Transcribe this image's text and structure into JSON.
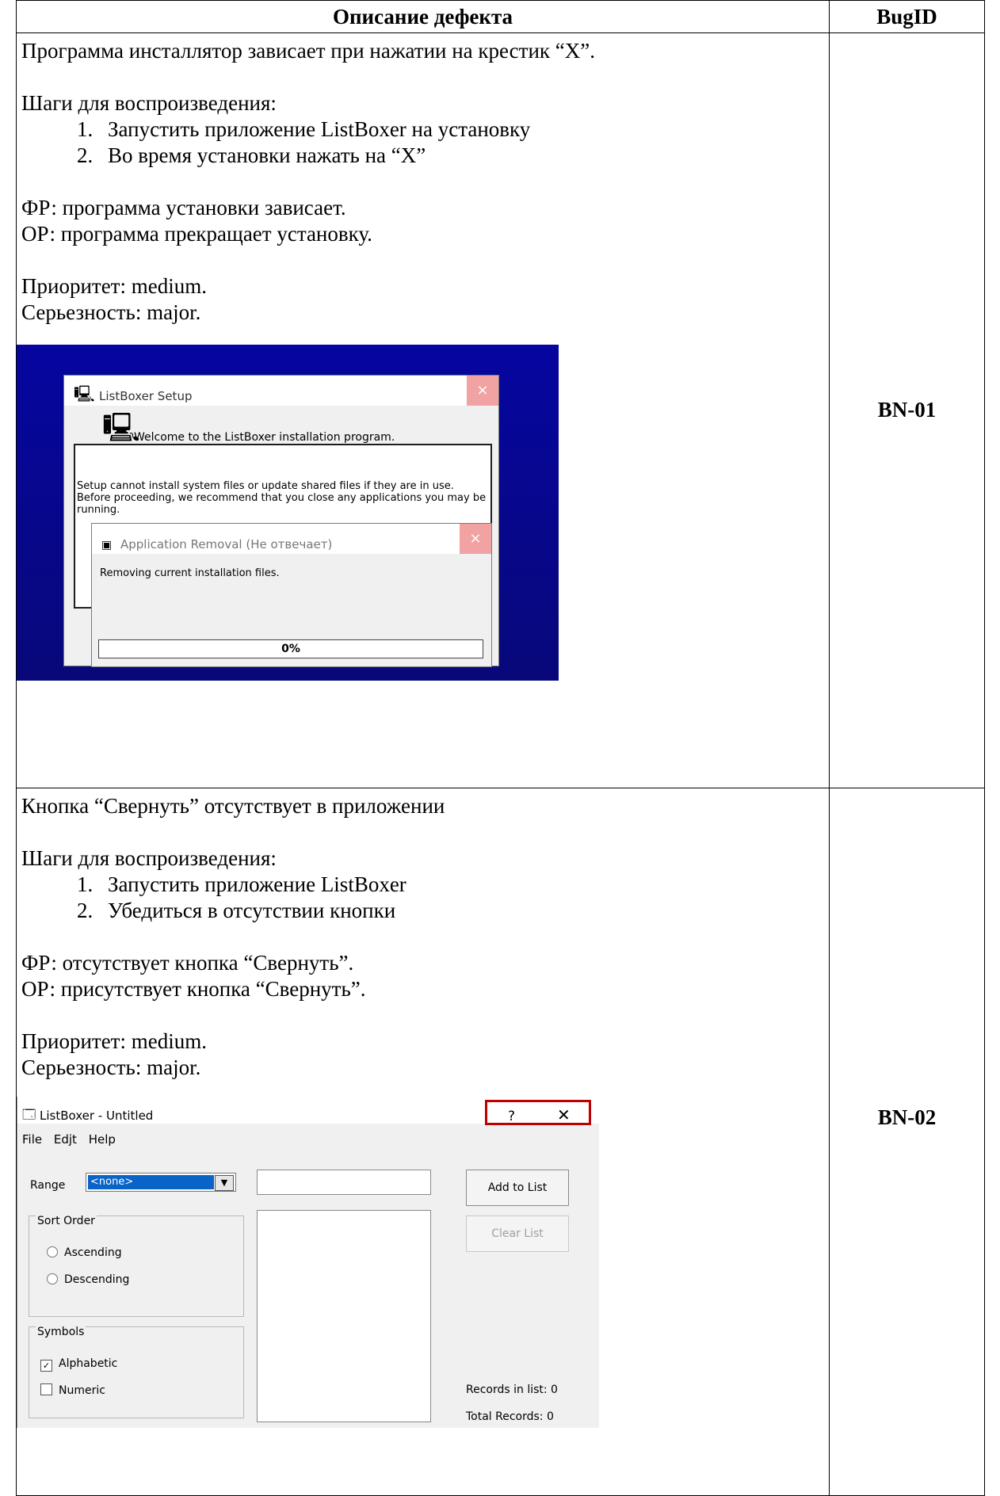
{
  "table": {
    "col_description": "Описание дефекта",
    "col_bugid": "BugID"
  },
  "bugs": [
    {
      "id": "BN-01",
      "summary": "Программа инсталлятор зависает при нажатии на крестик “X”.",
      "steps_title": "Шаги для воспроизведения:",
      "steps": [
        "Запустить приложение ListBoxer на установку",
        "Во время установки нажать на “X”"
      ],
      "actual": "ФР: программа установки зависает.",
      "expected": "ОР: программа прекращает установку.",
      "priority": "Приоритет: medium.",
      "severity": "Серьезность: major.",
      "screenshot": {
        "setup_title": "ListBoxer Setup",
        "welcome": "Welcome to the ListBoxer installation program.",
        "warning": "Setup cannot install system files or update shared files if they are in use. Before proceeding, we recommend that you close any applications you may be running.",
        "removal_title": "Application Removal (Не отвечает)",
        "removal_text": "Removing current installation files.",
        "progress_label": "0%",
        "progress_value": 0,
        "close_icon": "×"
      }
    },
    {
      "id": "BN-02",
      "summary": "Кнопка “Свернуть” отсутствует в приложении",
      "steps_title": "Шаги для воспроизведения:",
      "steps": [
        "Запустить приложение ListBoxer",
        "Убедиться в отсутствии кнопки"
      ],
      "actual": "ФР: отсутствует кнопка “Свернуть”.",
      "expected": "ОР: присутствует кнопка “Свернуть”.",
      "priority": "Приоритет: medium.",
      "severity": "Серьезность: major.",
      "screenshot": {
        "window_title": "ListBoxer - Untitled",
        "help_glyph": "?",
        "close_glyph": "✕",
        "menu": [
          "File",
          "Edjt",
          "Help"
        ],
        "range_label": "Range",
        "range_value": "<none>",
        "combo_arrow": "▼",
        "add_button": "Add to List",
        "clear_button": "Clear List",
        "sort_group": "Sort Order",
        "ascending": "Ascending",
        "descending": "Descending",
        "symbols_group": "Symbols",
        "alphabetic": "Alphabetic",
        "alphabetic_checked": true,
        "check_mark": "✓",
        "numeric": "Numeric",
        "records_in_list": "Records in list: 0",
        "total_records": "Total Records: 0"
      }
    }
  ]
}
